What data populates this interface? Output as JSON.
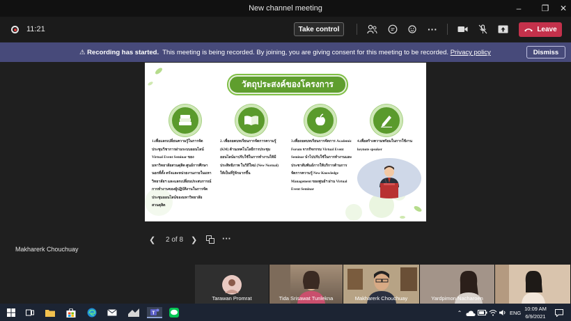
{
  "window": {
    "title": "New channel meeting"
  },
  "callbar": {
    "timer": "11:21",
    "take_control": "Take control",
    "leave": "Leave"
  },
  "banner": {
    "bold": "Recording has started.",
    "text": "This meeting is being recorded. By joining, you are giving consent for this meeting to be recorded.",
    "link": "Privacy policy",
    "dismiss": "Dismiss"
  },
  "slide": {
    "title": "วัตถุประสงค์ของโครงการ",
    "columns": [
      {
        "text": "1.เพื่อแลกเปลี่ยนความรู้ในการจัดประชุมวิชาการผ่านระบบออนไลน์ Virtual Event Seminar ของมหาวิทยาลัยสวนดุสิต ศูนย์การศึกษานอกที่ตั้ง ตรังและหน่วยงานภายในมหาวิทยาลัยฯ และแลกเปลี่ยนประสบการณ์การทำงานของผู้ปฏิบัติงานในการจัดประชุมออนไลน์ของมหาวิทยาลัยสวนดุสิต",
        "icon": "book-stack-icon"
      },
      {
        "text": "2. เพื่อถอดบทเรียนการจัดการความรู้ (KM) ด้านเทคโนโลยีการประชุมออนไลน์มาปรับใช้ในการทำงานให้มีประสิทธิภาพ ในวิถีใหม่ (New Normal) ให้เป็นที่รู้จักมากขึ้น",
        "icon": "open-book-icon"
      },
      {
        "text": "3.เพื่อถอดบทเรียนการจัดการ Academic Forum จากกิจกรรม Virtual Event Seminar นำไปปรับใช้ในการทำงานและประชาสัมพันธ์การให้บริการด้านการจัดการความรู้ New Knowledge Management ของศูนย์ฯ ผ่าน Virtual Event Seminar",
        "icon": "apple-icon"
      },
      {
        "text": "4.เพื่อสร้างความพร้อมในการใช้งาน keynote speaker",
        "icon": "pencil-icon"
      }
    ]
  },
  "slide_nav": {
    "page": "2 of 8"
  },
  "presenter": {
    "name": "Makharerk Chouchuay"
  },
  "participants": [
    {
      "name": "Tarawan Promrat"
    },
    {
      "name": "Tida Srisawat Tunlekna"
    },
    {
      "name": "Makharerk Chouchuay"
    },
    {
      "name": "Yardpimon Nacharoen"
    },
    {
      "name": ""
    }
  ],
  "taskbar": {
    "lang": "ENG",
    "time": "10:09 AM",
    "date": "6/9/2021"
  },
  "colors": {
    "leave": "#c4314b",
    "banner": "#474a7a",
    "slide_green": "#5f9e2e"
  }
}
